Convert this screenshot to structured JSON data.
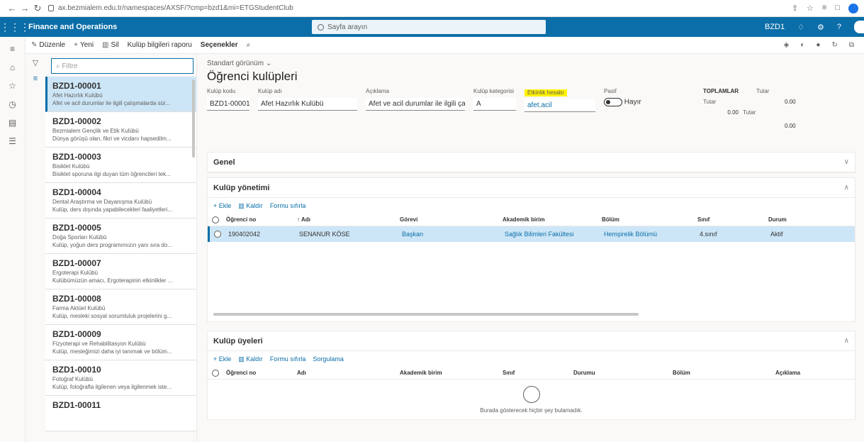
{
  "browser": {
    "url": "ax.bezmialem.edu.tr/namespaces/AXSF/?cmp=bzd1&mi=ETGStudentClub"
  },
  "appbar": {
    "name": "Finance and Operations",
    "search_placeholder": "Sayfa arayın",
    "company": "BZD1"
  },
  "actions": {
    "edit": "Düzenle",
    "new": "Yeni",
    "delete": "Sil",
    "report": "Kulüp bilgileri raporu",
    "options": "Seçenekler"
  },
  "filter": {
    "placeholder": "Filtre"
  },
  "list": [
    {
      "code": "BZD1-00001",
      "name": "Afet Hazırlık Kulübü",
      "desc": "Afet ve acil durumlar ile ilgili çalışmalarda sür..."
    },
    {
      "code": "BZD1-00002",
      "name": "Bezmialem Gençlik ve Etik Kulübü",
      "desc": "Dünya görüşü olan, fikri ve vicdanı hapsedilm..."
    },
    {
      "code": "BZD1-00003",
      "name": "Bisiklet Kulübü",
      "desc": "Bisiklet sporuna ilgi duyan tüm öğrencileri tek..."
    },
    {
      "code": "BZD1-00004",
      "name": "Dental Araştırma ve Dayanışma Kulübü",
      "desc": "Kulüp, ders dışında yapabilecekleri faaliyetleri..."
    },
    {
      "code": "BZD1-00005",
      "name": "Doğa Sporları Kulübü",
      "desc": "Kulüp, yoğun ders programımızın yanı sıra do..."
    },
    {
      "code": "BZD1-00007",
      "name": "Ergoterapi Kulübü",
      "desc": "Kulübümüzün amacı, Ergoterapinin etkinlikler ..."
    },
    {
      "code": "BZD1-00008",
      "name": "Farma Aktüel Kulübü",
      "desc": "Kulüp, mesleki sosyal sorumluluk projelerini g..."
    },
    {
      "code": "BZD1-00009",
      "name": "Fizyoterapi ve Rehabilitasyon Kulübü",
      "desc": "Kulüp, mesleğimizi daha iyi tanımak ve bölüm..."
    },
    {
      "code": "BZD1-00010",
      "name": "Fotoğraf Kulübü",
      "desc": "Kulüp, fotoğrafla ilgilenen veya ilgilenmek iste..."
    },
    {
      "code": "BZD1-00011",
      "name": "",
      "desc": ""
    }
  ],
  "detail": {
    "view": "Standart görünüm",
    "title": "Öğrenci kulüpleri",
    "fields": {
      "code_label": "Kulüp kodu",
      "code": "BZD1-00001",
      "name_label": "Kulüp adı",
      "name": "Afet Hazırlık Kulübü",
      "desc_label": "Açıklama",
      "desc": "Afet ve acil durumlar ile ilgili çal...",
      "cat_label": "Kulüp kategorisi",
      "cat": "A",
      "acc_label": "Etkinlik hesabı",
      "acc": "afet.acil",
      "passive_label": "Pasif",
      "passive": "Hayır"
    },
    "totals": {
      "title": "TOPLAMLAR",
      "col": "Tutar",
      "row_label": "Tutar",
      "v1": "0.00",
      "v2": "0.00",
      "col2": "Tutar",
      "v3": "0.00"
    }
  },
  "general": {
    "title": "Genel"
  },
  "management": {
    "title": "Kulüp yönetimi",
    "tools": [
      "Ekle",
      "Kaldır",
      "Formu sıfırla"
    ],
    "headers": [
      "Öğrenci no",
      "Adı",
      "Görevi",
      "Akademik birim",
      "Bölüm",
      "Sınıf",
      "Durum"
    ],
    "row": [
      "190402042",
      "SENANUR KÖSE",
      "Başkan",
      "Sağlık Bilimleri Fakültesi",
      "Hemşirelik Bölümü",
      "4.sınıf",
      "Aktif"
    ]
  },
  "members": {
    "title": "Kulüp üyeleri",
    "tools": [
      "Ekle",
      "Kaldır",
      "Formu sıfırla",
      "Sorgulama"
    ],
    "headers": [
      "Öğrenci no",
      "Adı",
      "Akademik birim",
      "Sınıf",
      "Durumu",
      "Bölüm",
      "Açıklama"
    ],
    "empty": "Burada gösterecek hiçbir şey bulamadık."
  }
}
